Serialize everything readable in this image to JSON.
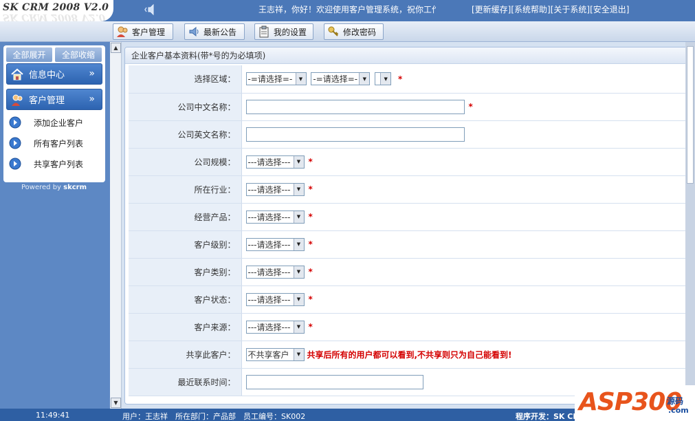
{
  "app": {
    "title": "SK CRM 2008 V2.0",
    "welcome": "王志祥，你好！欢迎使用客户管理系统，祝你工作愉快！",
    "top_links": [
      "[更新缓存]",
      "[系统帮助]",
      "[关于系统]",
      "[安全退出]"
    ]
  },
  "tabs": [
    {
      "label": "客户管理",
      "icon": "customer-icon"
    },
    {
      "label": "最新公告",
      "icon": "speaker-icon"
    },
    {
      "label": "我的设置",
      "icon": "clipboard-icon"
    },
    {
      "label": "修改密码",
      "icon": "key-icon"
    }
  ],
  "sidebar": {
    "expand_all": "全部展开",
    "collapse_all": "全部收缩",
    "sections": [
      {
        "label": "信息中心",
        "icon": "home-icon",
        "chevron": "»"
      },
      {
        "label": "客户管理",
        "icon": "customer-icon",
        "chevron": "»"
      }
    ],
    "items": [
      {
        "label": "添加企业客户",
        "icon": "arrow-circle-icon"
      },
      {
        "label": "所有客户列表",
        "icon": "arrow-circle-icon"
      },
      {
        "label": "共享客户列表",
        "icon": "arrow-circle-icon"
      }
    ],
    "powered_prefix": "Powered by ",
    "powered_brand": "skcrm"
  },
  "form": {
    "title": "企业客户基本资料(带*号的为必填项)",
    "region_label": "选择区域：",
    "region_select_1": "-=请选择=-",
    "region_select_2": "-=请选择=-",
    "region_select_3": "",
    "cn_name_label": "公司中文名称：",
    "en_name_label": "公司英文名称：",
    "scale_label": "公司规模：",
    "industry_label": "所在行业：",
    "products_label": "经营产品：",
    "level_label": "客户级别：",
    "type_label": "客户类别：",
    "status_label": "客户状态：",
    "source_label": "客户来源：",
    "share_label": "共享此客户：",
    "last_contact_label": "最近联系时间：",
    "select_placeholder": "---请选择---",
    "share_value": "不共享客户",
    "share_note": "共享后所有的用户都可以看到,不共享则只为自己能看到!",
    "required_mark": "*"
  },
  "status_bar": {
    "clock": "11:49:41",
    "user_info": "用户：王志祥　所在部门：产品部　员工编号：SK002",
    "developer": "程序开发：SK CRM 开发工作室"
  },
  "watermark": {
    "main": "ASP300",
    "cn": "源码",
    "com": ".com"
  },
  "colors": {
    "header_blue": "#4b78b8",
    "required_red": "#d40000",
    "watermark_orange": "#e8541c"
  }
}
